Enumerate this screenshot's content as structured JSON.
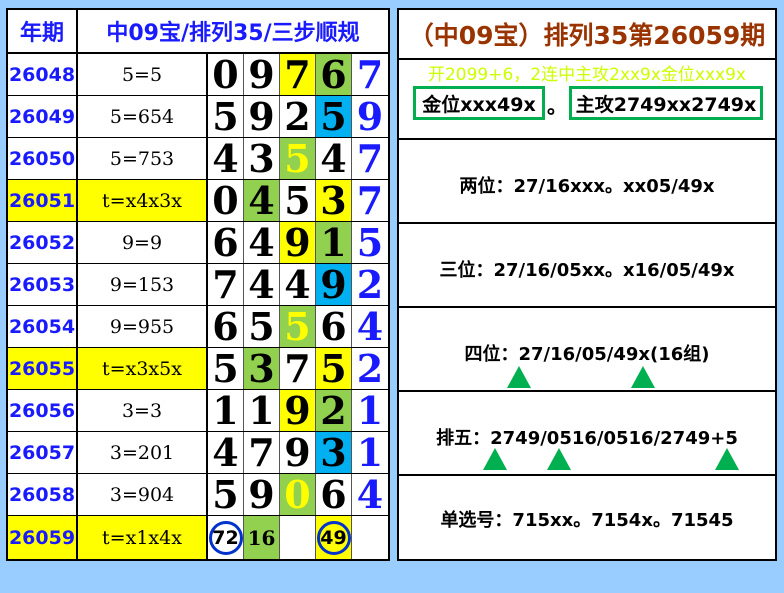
{
  "left": {
    "header": {
      "period": "年期",
      "title": "中09宝/排列35/三步顺规"
    },
    "rows": [
      {
        "period": "26048",
        "sum": "5=5",
        "digits": [
          "0",
          "9",
          "7",
          "6",
          "7"
        ]
      },
      {
        "period": "26049",
        "sum": "5=654",
        "digits": [
          "5",
          "9",
          "2",
          "5",
          "9"
        ]
      },
      {
        "period": "26050",
        "sum": "5=753",
        "digits": [
          "4",
          "3",
          "5",
          "4",
          "7"
        ]
      },
      {
        "period": "26051",
        "sum": "t=x4x3x",
        "digits": [
          "0",
          "4",
          "5",
          "3",
          "7"
        ]
      },
      {
        "period": "26052",
        "sum": "9=9",
        "digits": [
          "6",
          "4",
          "9",
          "1",
          "5"
        ]
      },
      {
        "period": "26053",
        "sum": "9=153",
        "digits": [
          "7",
          "4",
          "4",
          "9",
          "2"
        ]
      },
      {
        "period": "26054",
        "sum": "9=955",
        "digits": [
          "6",
          "5",
          "5",
          "6",
          "4"
        ]
      },
      {
        "period": "26055",
        "sum": "t=x3x5x",
        "digits": [
          "5",
          "3",
          "7",
          "5",
          "2"
        ]
      },
      {
        "period": "26056",
        "sum": "3=3",
        "digits": [
          "1",
          "1",
          "9",
          "2",
          "1"
        ]
      },
      {
        "period": "26057",
        "sum": "3=201",
        "digits": [
          "4",
          "7",
          "9",
          "3",
          "1"
        ]
      },
      {
        "period": "26058",
        "sum": "3=904",
        "digits": [
          "5",
          "9",
          "0",
          "6",
          "4"
        ]
      },
      {
        "period": "26059",
        "sum": "t=x1x4x",
        "digits": [
          "72",
          "16",
          "",
          "49",
          ""
        ]
      }
    ]
  },
  "right": {
    "title": "（中09宝）排列35第26059期",
    "neon": "开2099+6，2连中主攻2xx9x金位xxx9x",
    "gold": "金位xxx49x",
    "sep": "。",
    "main": "主攻2749xx2749x",
    "two": "两位：27/16xxx。xx05/49x",
    "three": "三位：27/16/05xx。x16/05/49x",
    "four": "四位：27/16/05/49x(16组)",
    "five": "排五：2749/0516/0516/2749+5",
    "single": "单选号：715xx。7154x。71545"
  },
  "colors": {
    "background": "#99ccff",
    "period_blue": "#1a1aff",
    "title_brown": "#993300",
    "yellow": "#ffff00",
    "green": "#92d050",
    "cyan": "#00b0f0",
    "box_green": "#00b050",
    "circle_blue": "#0033cc"
  }
}
